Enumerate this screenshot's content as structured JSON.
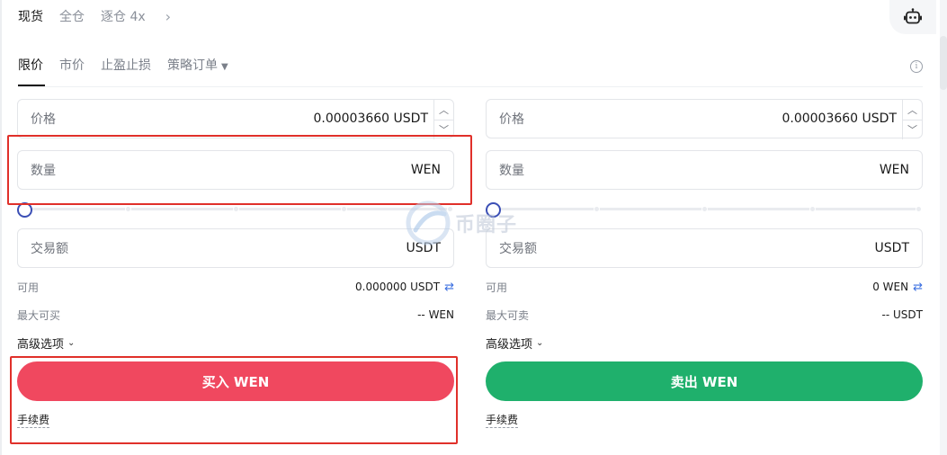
{
  "top_modes": [
    "现货",
    "全仓",
    "逐仓 4x"
  ],
  "tabs": {
    "limit": "限价",
    "market": "市价",
    "tpsl": "止盈止损",
    "strategy": "策略订单"
  },
  "buy": {
    "price_label": "价格",
    "price_value": "0.00003660 USDT",
    "qty_label": "数量",
    "qty_unit": "WEN",
    "amount_label": "交易额",
    "amount_unit": "USDT",
    "available_label": "可用",
    "available_value": "0.000000 USDT",
    "max_label": "最大可买",
    "max_value": "-- WEN",
    "advanced_label": "高级选项",
    "button_label": "买入 WEN",
    "fee_label": "手续费",
    "slider_value": 0
  },
  "sell": {
    "price_label": "价格",
    "price_value": "0.00003660 USDT",
    "qty_label": "数量",
    "qty_unit": "WEN",
    "amount_label": "交易额",
    "amount_unit": "USDT",
    "available_label": "可用",
    "available_value": "0 WEN",
    "max_label": "最大可卖",
    "max_value": "-- USDT",
    "advanced_label": "高级选项",
    "button_label": "卖出 WEN",
    "fee_label": "手续费",
    "slider_value": 0
  },
  "watermark_text": "币圈子",
  "colors": {
    "buy": "#f0485f",
    "sell": "#1fb06c",
    "slider_thumb": "#3b4fb5",
    "annotation": "#e0302a"
  },
  "icons": {
    "robot": "robot-icon",
    "info": "info-icon",
    "swap": "swap-icon",
    "chevron": "chevron-right-icon"
  }
}
